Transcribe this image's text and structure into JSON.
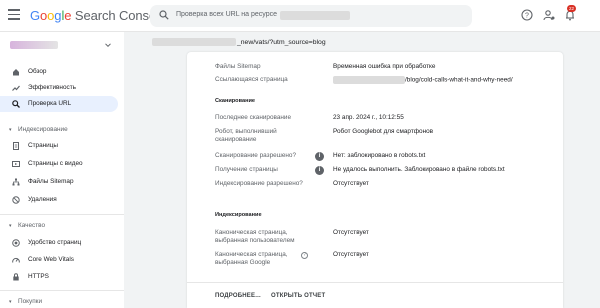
{
  "header": {
    "logo_g1": "G",
    "logo_g2": "o",
    "logo_g3": "o",
    "logo_g4": "g",
    "logo_g5": "l",
    "logo_g6": "e",
    "logo_product": "Search Console",
    "search_placeholder": "Проверка всех URL на ресурсе",
    "notification_count": "22"
  },
  "icons": {
    "menu": "menu-icon",
    "search": "search-icon",
    "help": "help-icon",
    "manage_users": "manage-users-icon",
    "notifications": "bell-icon"
  },
  "sidebar": {
    "top_items": [
      {
        "label": "Обзор",
        "icon": "home-icon"
      },
      {
        "label": "Эффективность",
        "icon": "trending-icon"
      },
      {
        "label": "Проверка URL",
        "icon": "search-icon",
        "active": true
      }
    ],
    "sections": {
      "indexing": "Индексирование",
      "quality": "Качество",
      "shopping": "Покупки"
    },
    "indexing_items": [
      {
        "label": "Страницы",
        "icon": "pages-icon"
      },
      {
        "label": "Страницы с видео",
        "icon": "video-pages-icon"
      },
      {
        "label": "Файлы Sitemap",
        "icon": "sitemap-icon"
      },
      {
        "label": "Удаления",
        "icon": "removals-icon"
      }
    ],
    "quality_items": [
      {
        "label": "Удобство страниц",
        "icon": "page-experience-icon"
      },
      {
        "label": "Core Web Vitals",
        "icon": "speed-icon"
      },
      {
        "label": "HTTPS",
        "icon": "lock-icon"
      }
    ]
  },
  "breadcrumb": {
    "url_suffix": "_new/vats/?utm_source=blog"
  },
  "details": {
    "sitemaps_label": "Файлы Sitemap",
    "sitemaps_value": "Временная ошибка при обработке",
    "referring_label": "Ссылающаяся страница",
    "referring_value": "/blog/cold-calls-what-it-and-why-need/",
    "crawl_section": "Сканирование",
    "last_crawl_label": "Последнее сканирование",
    "last_crawl_value": "23 апр. 2024 г., 10:12:55",
    "crawled_as_label": "Робот, выполнивший сканирование",
    "crawled_as_value": "Робот Googlebot для смартфонов",
    "crawl_allowed_label": "Сканирование разрешено?",
    "crawl_allowed_value": "Нет: заблокировано в robots.txt",
    "page_fetch_label": "Получение страницы",
    "page_fetch_value": "Не удалось выполнить. Заблокировано в файле robots.txt",
    "indexing_allowed_label": "Индексирование разрешено?",
    "indexing_allowed_value": "Отсутствует",
    "indexing_section": "Индексирование",
    "user_canonical_label": "Каноническая страница, выбранная пользователем",
    "user_canonical_value": "Отсутствует",
    "google_canonical_label": "Каноническая страница, выбранная Google",
    "google_canonical_value": "Отсутствует",
    "info_glyph": "i",
    "help_glyph": "?"
  },
  "footer": {
    "more_button": "ПОДРОБНЕЕ...",
    "open_report_button": "ОТКРЫТЬ ОТЧЕТ"
  }
}
